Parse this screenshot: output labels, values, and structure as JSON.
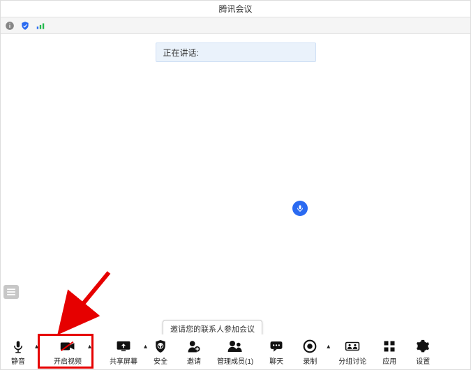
{
  "titlebar": {
    "title": "腾讯会议"
  },
  "status": {
    "speaking_label": "正在讲话:"
  },
  "tooltip": {
    "invite": "邀请您的联系人参加会议"
  },
  "toolbar": {
    "mute": "静音",
    "video": "开启视频",
    "share": "共享屏幕",
    "security": "安全",
    "invite": "邀请",
    "members": "管理成员(1)",
    "chat": "聊天",
    "record": "录制",
    "breakout": "分组讨论",
    "apps": "应用",
    "settings": "设置"
  }
}
